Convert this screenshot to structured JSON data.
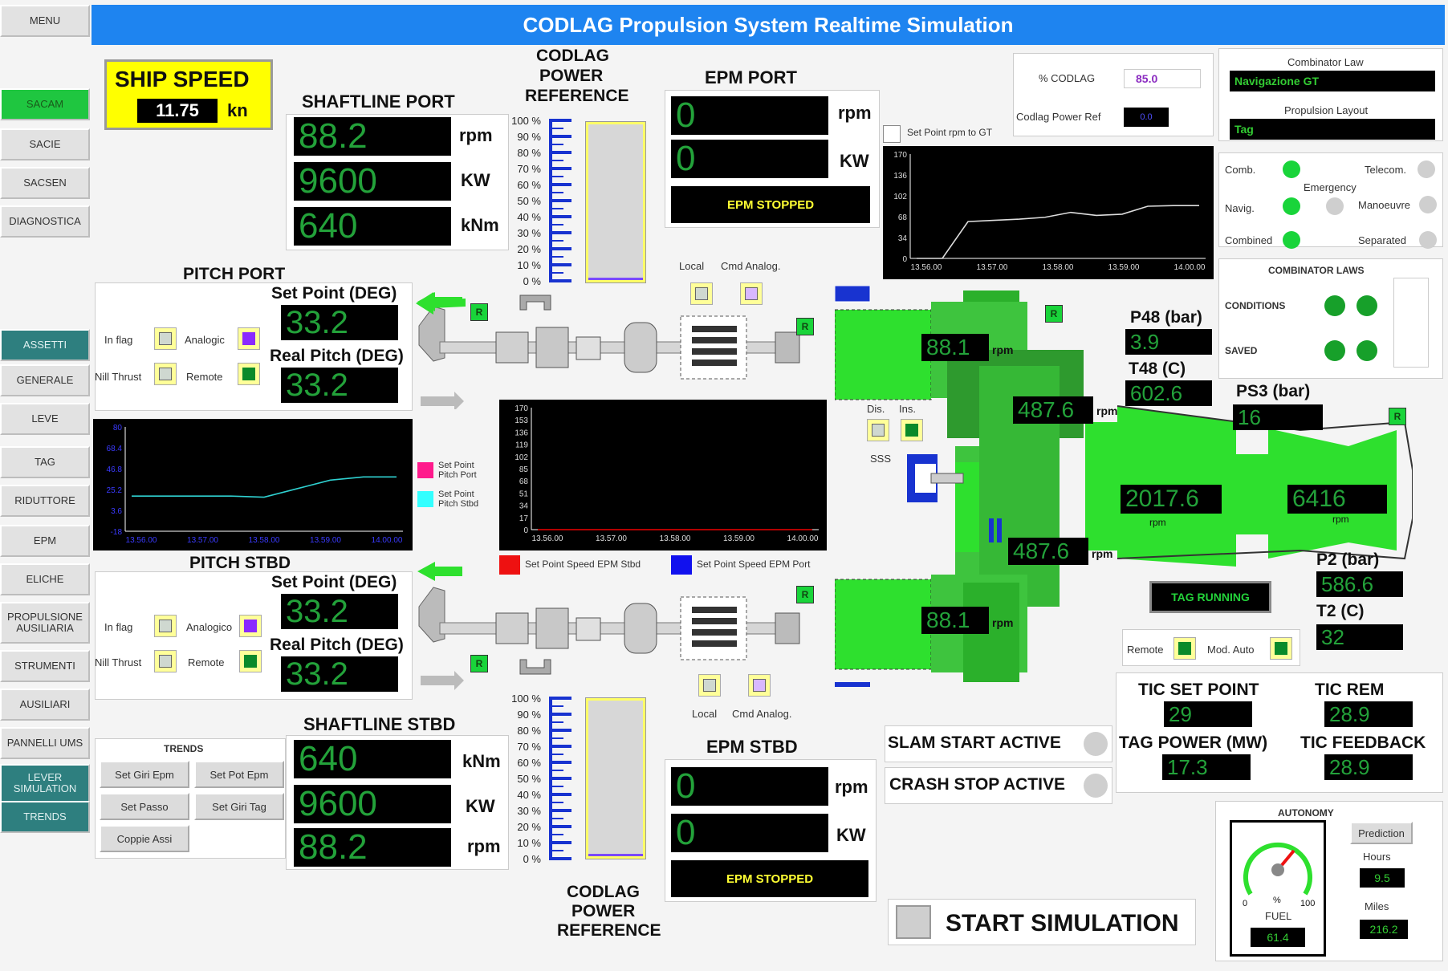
{
  "title": "CODLAG Propulsion System Realtime Simulation",
  "sidebar": {
    "items": [
      "MENU",
      "SACAM",
      "SACIE",
      "SACSEN",
      "DIAGNOSTICA",
      "ASSETTI",
      "GENERALE",
      "LEVE",
      "TAG",
      "RIDUTTORE",
      "EPM",
      "ELICHE",
      "PROPULSIONE AUSILIARIA",
      "STRUMENTI",
      "AUSILIARI",
      "PANNELLI UMS",
      "LEVER SIMULATION",
      "TRENDS"
    ]
  },
  "ship_speed": {
    "label": "SHIP SPEED",
    "value": "11.75",
    "unit": "kn"
  },
  "shaftline_port": {
    "label": "SHAFTLINE PORT",
    "rpm": "88.2",
    "kw": "9600",
    "knm": "640",
    "u_rpm": "rpm",
    "u_kw": "KW",
    "u_knm": "kNm"
  },
  "shaftline_stbd": {
    "label": "SHAFTLINE STBD",
    "knm": "640",
    "kw": "9600",
    "rpm": "88.2",
    "u_rpm": "rpm",
    "u_kw": "KW",
    "u_knm": "kNm"
  },
  "codlag_ref": {
    "label_l1": "CODLAG",
    "label_l2": "POWER",
    "label_l3": "REFERENCE",
    "ticks": [
      "100 %",
      "90 %",
      "80 %",
      "70 %",
      "60 %",
      "50 %",
      "40 %",
      "30 %",
      "20 %",
      "10 %",
      "0 %"
    ]
  },
  "epm_port": {
    "label": "EPM PORT",
    "rpm": "0",
    "kw": "0",
    "u_rpm": "rpm",
    "u_kw": "KW",
    "status": "EPM STOPPED"
  },
  "epm_stbd": {
    "label": "EPM STBD",
    "rpm": "0",
    "kw": "0",
    "u_rpm": "rpm",
    "u_kw": "KW",
    "status": "EPM STOPPED"
  },
  "codlag_box": {
    "pct_label": "% CODLAG",
    "pct_value": "85.0",
    "ref_label": "Codlag Power Ref",
    "ref_value": "0.0",
    "setpoint_label": "Set Point rpm to GT"
  },
  "combinator": {
    "law_label": "Combinator Law",
    "law_value": "Navigazione GT",
    "layout_label": "Propulsion Layout",
    "layout_value": "Tag"
  },
  "modes": {
    "comb": "Comb.",
    "telecom": "Telecom.",
    "emergency": "Emergency",
    "navig": "Navig.",
    "manoeuvre": "Manoeuvre",
    "combined": "Combined",
    "separated": "Separated"
  },
  "combinator_laws": {
    "title": "COMBINATOR LAWS",
    "conditions": "CONDITIONS",
    "saved": "SAVED"
  },
  "pitch_port": {
    "label": "PITCH PORT",
    "sp_label": "Set Point (DEG)",
    "sp": "33.2",
    "rp_label": "Real Pitch (DEG)",
    "rp": "33.2",
    "inflag": "In flag",
    "analogic": "Analogic",
    "nill": "Nill Thrust",
    "remote": "Remote"
  },
  "pitch_stbd": {
    "label": "PITCH STBD",
    "sp_label": "Set Point (DEG)",
    "sp": "33.2",
    "rp_label": "Real Pitch (DEG)",
    "rp": "33.2",
    "inflag": "In flag",
    "analogic": "Analogico",
    "nill": "Nill Thrust",
    "remote": "Remote"
  },
  "legend": {
    "sp_port": "Set Point Pitch Port",
    "sp_stbd": "Set Point Pitch Stbd",
    "epm_stbd": "Set Point Speed EPM Stbd",
    "epm_port": "Set Point Speed EPM Port"
  },
  "local_cmd": {
    "local": "Local",
    "cmd": "Cmd Analog."
  },
  "engine": {
    "rpm_top": "88.1",
    "rpm_mid": "487.6",
    "rpm_low": "487.6",
    "rpm_bot": "88.1",
    "rpm_gg": "2017.6",
    "rpm_pt": "6416",
    "u": "rpm",
    "dis": "Dis.",
    "ins": "Ins.",
    "sss": "SSS",
    "r": "R"
  },
  "gas": {
    "p48_label": "P48 (bar)",
    "p48": "3.9",
    "t48_label": "T48 (C)",
    "t48": "602.6",
    "ps3_label": "PS3 (bar)",
    "ps3": "16",
    "p2_label": "P2 (bar)",
    "p2": "586.6",
    "t2_label": "T2 (C)",
    "t2": "32",
    "status": "TAG RUNNING",
    "remote": "Remote",
    "mod_auto": "Mod. Auto"
  },
  "tic": {
    "setpoint_label": "TIC SET POINT",
    "setpoint": "29",
    "rem_label": "TIC REM",
    "rem": "28.9",
    "power_label": "TAG POWER (MW)",
    "power": "17.3",
    "feedback_label": "TIC FEEDBACK",
    "feedback": "28.9"
  },
  "flags": {
    "slam": "SLAM START ACTIVE",
    "crash": "CRASH STOP ACTIVE"
  },
  "start_sim": "START SIMULATION",
  "trends": {
    "title": "TRENDS",
    "b1": "Set Giri Epm",
    "b2": "Set Pot Epm",
    "b3": "Set Passo",
    "b4": "Set Giri Tag",
    "b5": "Coppie Assi"
  },
  "autonomy": {
    "title": "AUTONOMY",
    "prediction": "Prediction",
    "hours_label": "Hours",
    "hours": "9.5",
    "miles_label": "Miles",
    "miles": "216.2",
    "fuel_label": "FUEL",
    "fuel": "61.4",
    "g0": "0",
    "g100": "100",
    "gpct": "%"
  },
  "chart_data": [
    {
      "type": "line",
      "name": "gt_rpm_trend",
      "x": [
        "13.56.00",
        "13.57.00",
        "13.58.00",
        "13.59.00",
        "14.00.00"
      ],
      "y_ticks": [
        "170",
        "136",
        "102",
        "68",
        "34",
        "0"
      ],
      "ylim": [
        0,
        170
      ],
      "values": [
        0,
        0,
        60,
        62,
        64,
        67,
        75,
        70,
        72,
        85,
        86,
        86
      ]
    },
    {
      "type": "line",
      "name": "pitch_trend",
      "x": [
        "13.56.00",
        "13.57.00",
        "13.58.00",
        "13.59.00",
        "14.00.00"
      ],
      "y_ticks": [
        "80",
        "68.4",
        "46.8",
        "25.2",
        "3.6",
        "-18"
      ],
      "ylim": [
        -18,
        80
      ],
      "values": [
        15,
        15,
        15,
        15,
        14,
        22,
        30,
        33,
        33
      ]
    },
    {
      "type": "line",
      "name": "epm_speed_trend",
      "x": [
        "13.56.00",
        "13.57.00",
        "13.58.00",
        "13.59.00",
        "14.00.00"
      ],
      "y_ticks": [
        "170",
        "153",
        "136",
        "119",
        "102",
        "85",
        "68",
        "51",
        "34",
        "17",
        "0"
      ],
      "ylim": [
        0,
        170
      ],
      "values": [
        0,
        0,
        0,
        0,
        0
      ]
    }
  ]
}
